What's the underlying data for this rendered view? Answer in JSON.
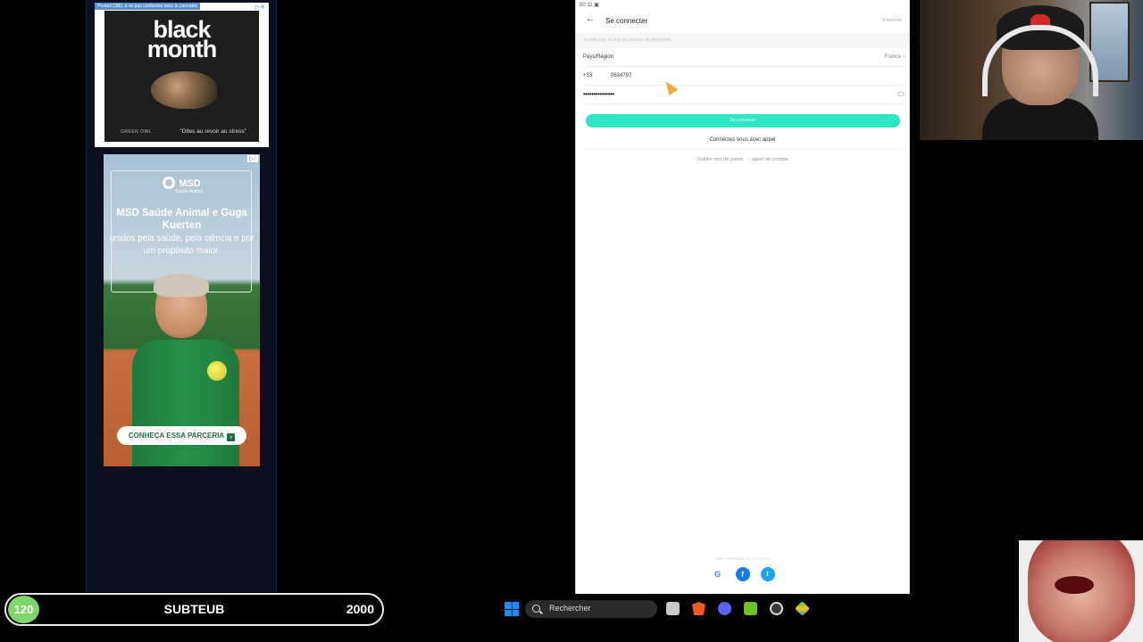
{
  "ads": {
    "ad1": {
      "tag": "Produit CBD, à ne pas confondre avec le cannabis",
      "title_line1": "black",
      "title_line2": "month",
      "brand": "GREEN OWL",
      "slogan": "\"Dites au revoir au stress\""
    },
    "ad2": {
      "logo": "MSD",
      "logo_sub": "Saúde Animal",
      "headline": "MSD Saúde Animal e Guga Kuerten",
      "body": "unidos pela saúde, pela ciência e por um propósito maior.",
      "cta": "CONHEÇA ESSA PARCERIA"
    }
  },
  "app": {
    "status_time": "00:11",
    "title": "Se connecter",
    "register": "S'inscrire",
    "email_hint": "E-mail (opt. et liste au numéro de téléphone",
    "country_label": "Pays/Région",
    "country_value": "France",
    "dial_code": "+33",
    "phone_value": "0634797",
    "password_mask": "•••••••••••••••",
    "login_button": "Se connecter",
    "call_login": "Connectez-vous avec appel",
    "forgot_password": "Oublier mot de passe",
    "call_account": "appel de compte",
    "other_methods": "Autres méthodes de connexion",
    "social": [
      "Google",
      "Facebook",
      "Twitter"
    ]
  },
  "overlay": {
    "sub_count": "120",
    "sub_label": "SUBTEUB",
    "sub_goal": "2000"
  },
  "taskbar": {
    "search_label": "Rechercher",
    "apps": [
      "file-explorer-icon",
      "brave-icon",
      "discord-icon",
      "green-app-icon",
      "obs-icon",
      "bluestacks-icon"
    ]
  }
}
